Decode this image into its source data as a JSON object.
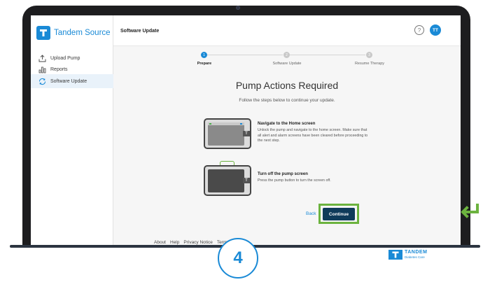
{
  "app": {
    "brand": "Tandem Source",
    "page_title": "Software Update"
  },
  "sidebar": {
    "items": [
      {
        "label": "Upload Pump",
        "icon": "upload-icon",
        "active": false
      },
      {
        "label": "Reports",
        "icon": "bar-chart-icon",
        "active": false
      },
      {
        "label": "Software Update",
        "icon": "refresh-icon",
        "active": true
      }
    ]
  },
  "header": {
    "help_label": "?",
    "avatar_initials": "TT"
  },
  "stepper": {
    "steps": [
      {
        "number": "1",
        "label": "Prepare",
        "active": true
      },
      {
        "number": "2",
        "label": "Software Update",
        "active": false
      },
      {
        "number": "3",
        "label": "Resume Therapy",
        "active": false
      }
    ]
  },
  "main": {
    "title": "Pump Actions Required",
    "subtitle": "Follow the steps below to continue your update.",
    "steps": [
      {
        "title": "Navigate to the Home screen",
        "text": "Unlock the pump and navigate to the home screen. Make sure that all alert and alarm screens have been cleared before proceeding to the next step."
      },
      {
        "title": "Turn off the pump screen",
        "text": "Press the pump button to turn the screen off."
      }
    ],
    "back_label": "Back",
    "continue_label": "Continue"
  },
  "footer": {
    "links": [
      "About",
      "Help",
      "Privacy Notice",
      "Terms of Use"
    ],
    "brand_name": "TANDEM",
    "brand_sub": "Diabetes Care"
  },
  "overlay": {
    "step_number": "4"
  },
  "colors": {
    "accent": "#1a8ad6",
    "highlight": "#6cb33f",
    "primary_button": "#0f3b5a"
  }
}
